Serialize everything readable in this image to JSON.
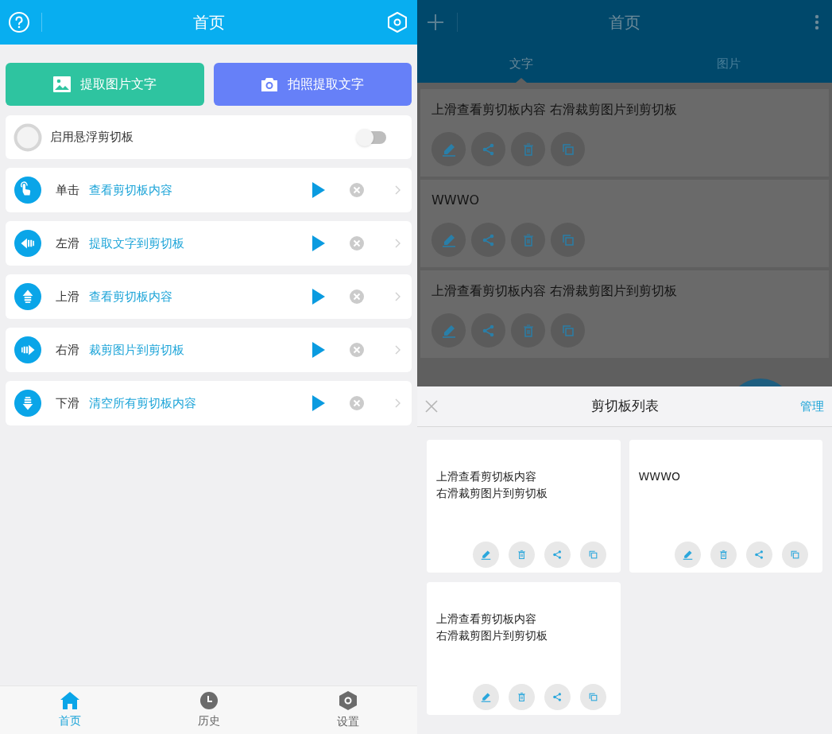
{
  "left": {
    "header": {
      "title": "首页"
    },
    "actions": [
      {
        "kind": "image",
        "label": "提取图片文字"
      },
      {
        "kind": "camera",
        "label": "拍照提取文字"
      }
    ],
    "float_toggle": {
      "label": "启用悬浮剪切板",
      "on": false
    },
    "gestures": [
      {
        "kind": "tap",
        "gesture": "单击",
        "action": "查看剪切板内容"
      },
      {
        "kind": "left",
        "gesture": "左滑",
        "action": "提取文字到剪切板"
      },
      {
        "kind": "up",
        "gesture": "上滑",
        "action": "查看剪切板内容"
      },
      {
        "kind": "right",
        "gesture": "右滑",
        "action": "裁剪图片到剪切板"
      },
      {
        "kind": "down",
        "gesture": "下滑",
        "action": "清空所有剪切板内容"
      }
    ],
    "nav": [
      {
        "kind": "home",
        "label": "首页",
        "selected": true
      },
      {
        "kind": "history",
        "label": "历史",
        "selected": false
      },
      {
        "kind": "settings",
        "label": "设置",
        "selected": false
      }
    ]
  },
  "right": {
    "header": {
      "title": "首页"
    },
    "tabs": [
      {
        "label": "文字",
        "selected": true
      },
      {
        "label": "图片",
        "selected": false
      }
    ],
    "clips": [
      {
        "text": "上滑查看剪切板内容 右滑裁剪图片到剪切板"
      },
      {
        "text": "WWWO"
      },
      {
        "text": "上滑查看剪切板内容 右滑裁剪图片到剪切板"
      }
    ],
    "sheet": {
      "title": "剪切板列表",
      "action": "管理",
      "clips": [
        {
          "lines": [
            "上滑查看剪切板内容",
            "右滑裁剪图片到剪切板"
          ]
        },
        {
          "lines": [
            "WWWO"
          ]
        },
        {
          "lines": [
            "上滑查看剪切板内容",
            "右滑裁剪图片到剪切板"
          ]
        }
      ]
    }
  }
}
